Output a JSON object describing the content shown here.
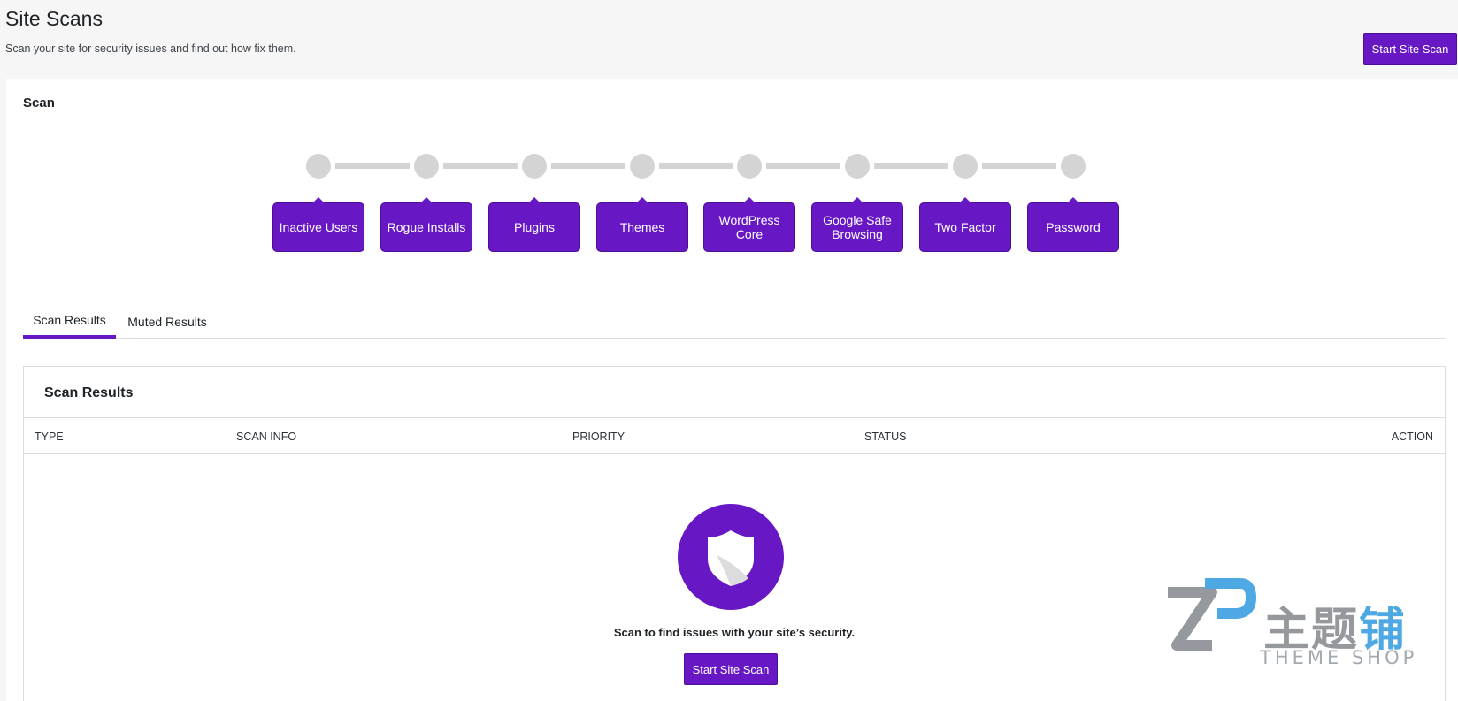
{
  "header": {
    "title": "Site Scans",
    "subtitle": "Scan your site for security issues and find out how fix them.",
    "scan_button": "Start Site Scan"
  },
  "scan_panel": {
    "title": "Scan",
    "steps": [
      {
        "label": "Inactive Users"
      },
      {
        "label": "Rogue Installs"
      },
      {
        "label": "Plugins"
      },
      {
        "label": "Themes"
      },
      {
        "label": "WordPress Core"
      },
      {
        "label": "Google Safe Browsing"
      },
      {
        "label": "Two Factor"
      },
      {
        "label": "Password"
      }
    ]
  },
  "tabs": [
    {
      "label": "Scan Results",
      "active": true
    },
    {
      "label": "Muted Results",
      "active": false
    }
  ],
  "results": {
    "title": "Scan Results",
    "columns": [
      "TYPE",
      "SCAN INFO",
      "PRIORITY",
      "STATUS",
      "ACTION"
    ],
    "empty_icon": "shield-icon",
    "empty_message": "Scan to find issues with your site’s security.",
    "scan_button": "Start Site Scan"
  },
  "watermark": {
    "logo_text": "主题",
    "logo_text_accent": "铺",
    "sub_text": "THEME SHOP"
  },
  "colors": {
    "accent": "#6817c5",
    "step_inactive": "#d4d4d4",
    "background": "#f6f6f6"
  }
}
